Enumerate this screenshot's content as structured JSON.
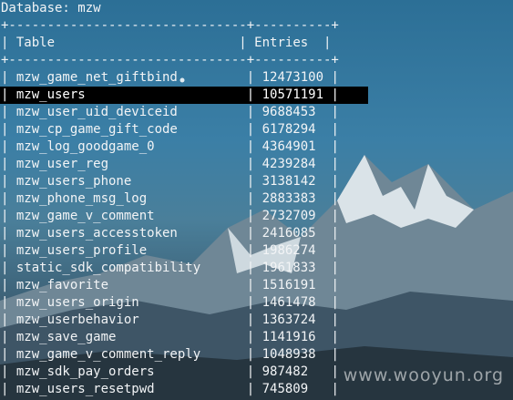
{
  "terminal": {
    "header": "Database: mzw",
    "border": "+-------------------------------+----------+",
    "columns": {
      "table": "Table",
      "entries": "Entries"
    },
    "rows": [
      {
        "table": "mzw_game_net_giftbind",
        "entries": "12473100"
      },
      {
        "table": "mzw_users",
        "entries": "10571191"
      },
      {
        "table": "mzw_user_uid_deviceid",
        "entries": "9688453"
      },
      {
        "table": "mzw_cp_game_gift_code",
        "entries": "6178294"
      },
      {
        "table": "mzw_log_goodgame_0",
        "entries": "4364901"
      },
      {
        "table": "mzw_user_reg",
        "entries": "4239284"
      },
      {
        "table": "mzw_users_phone",
        "entries": "3138142"
      },
      {
        "table": "mzw_phone_msg_log",
        "entries": "2883383"
      },
      {
        "table": "mzw_game_v_comment",
        "entries": "2732709"
      },
      {
        "table": "mzw_users_accesstoken",
        "entries": "2416085"
      },
      {
        "table": "mzw_users_profile",
        "entries": "1986274"
      },
      {
        "table": "static_sdk_compatibility",
        "entries": "1961833"
      },
      {
        "table": "mzw_favorite",
        "entries": "1516191"
      },
      {
        "table": "mzw_users_origin",
        "entries": "1461478"
      },
      {
        "table": "mzw_userbehavior",
        "entries": "1363724"
      },
      {
        "table": "mzw_save_game",
        "entries": "1141916"
      },
      {
        "table": "mzw_game_v_comment_reply",
        "entries": "1048938"
      },
      {
        "table": "mzw_sdk_pay_orders",
        "entries": "987482"
      },
      {
        "table": "mzw_users_resetpwd",
        "entries": "745809"
      }
    ],
    "selected_row": 1
  },
  "watermark": "www.wooyun.org"
}
